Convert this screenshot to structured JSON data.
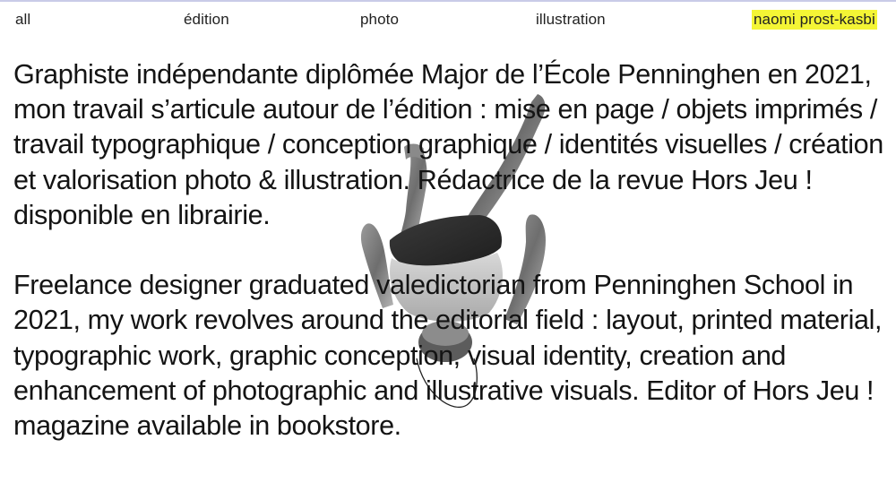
{
  "nav": {
    "all": "all",
    "edition": "édition",
    "photo": "photo",
    "illustration": "illustration",
    "name": "naomi prost-kasbi"
  },
  "colors": {
    "highlight": "#f4f535",
    "text": "#141414"
  },
  "bio": {
    "fr": "Graphiste indépendante diplômée Major de l’École Penninghen en 2021, mon travail s’articule autour de l’édition : mise en page / objets imprimés / travail typographique / conception graphique / identités visuelles / création et valorisation photo & illustration. Rédactrice de la revue Hors Jeu ! disponible en librairie.",
    "en": "Freelance designer graduated valedictorian from Penninghen School in 2021, my work revolves around the editorial field : layout, printed material, typographic work, graphic conception, visual identity, creation and enhancement of photographic and illustrative visuals. Editor of Hors Jeu ! magazine available in bookstore."
  }
}
